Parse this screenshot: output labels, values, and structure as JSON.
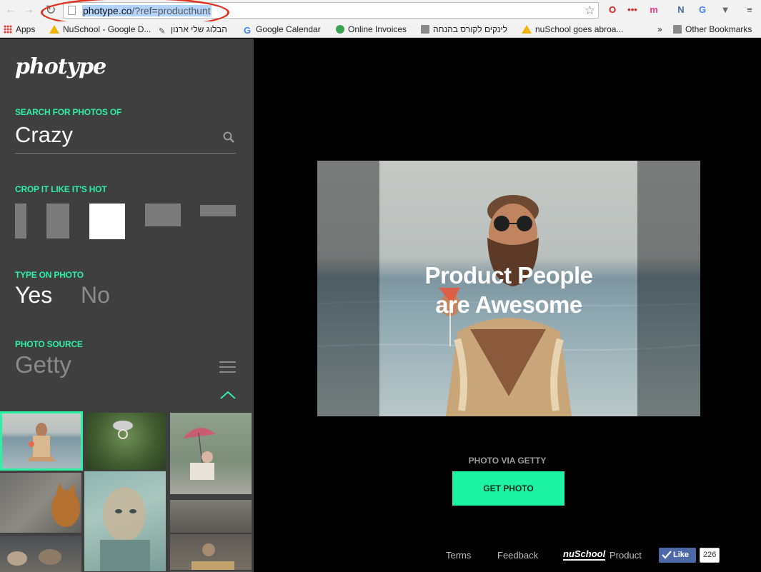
{
  "browser": {
    "url_domain": "photype.co",
    "url_rest": "/?ref=producthunt",
    "back": "←",
    "forward": "→",
    "reload": "↻",
    "star": "☆",
    "extensions": [
      {
        "glyph": "O",
        "color": "#d91c1c",
        "name": "opera-icon"
      },
      {
        "glyph": "•••",
        "color": "#d32f2f",
        "name": "dots-extension-icon"
      },
      {
        "glyph": "m",
        "color": "#e23b8a",
        "name": "m-extension-icon"
      },
      {
        "glyph": "N",
        "color": "#4a6fa5",
        "name": "n-extension-icon"
      },
      {
        "glyph": "G",
        "color": "#4285f4",
        "name": "translate-icon"
      },
      {
        "glyph": "▼",
        "color": "#6a6a6a",
        "name": "pocket-icon"
      },
      {
        "glyph": "≡",
        "color": "#555",
        "name": "menu-icon"
      }
    ]
  },
  "bookmarks": {
    "items": [
      "Apps",
      "NuSchool - Google D...",
      "הבלוג שלי ארנון",
      "Google Calendar",
      "Online Invoices",
      "לינקים לקורס בהנחה",
      "nuSchool goes abroa..."
    ],
    "overflow": "»",
    "other": "Other Bookmarks"
  },
  "sidebar": {
    "logo": "photype",
    "search_label": "SEARCH FOR PHOTOS OF",
    "search_value": "Crazy",
    "crop_label": "CROP IT LIKE IT'S HOT",
    "type_label": "TYPE ON PHOTO",
    "type_yes": "Yes",
    "type_no": "No",
    "source_label": "PHOTO SOURCE",
    "source_value": "Getty"
  },
  "main": {
    "headline_line1": "Product People",
    "headline_line2": "are Awesome",
    "via": "PHOTO VIA GETTY",
    "get_photo": "GET PHOTO",
    "terms": "Terms",
    "feedback": "Feedback",
    "nuschool": "nuSchool",
    "product": "Product",
    "like": "Like",
    "like_count": "226"
  },
  "colors": {
    "accent": "#2ef0a5",
    "button": "#1cf3a3",
    "sidebar": "#3f3f3f"
  }
}
